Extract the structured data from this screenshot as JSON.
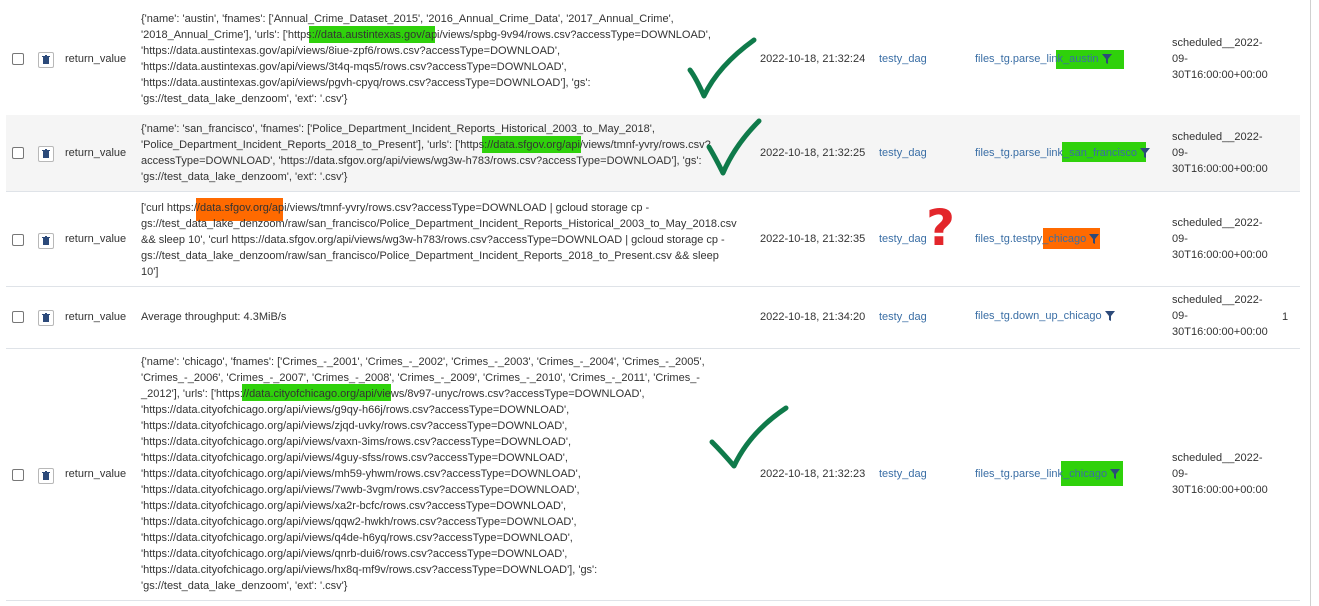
{
  "rows": [
    {
      "key": "return_value",
      "value": "{'name': 'austin', 'fnames': ['Annual_Crime_Dataset_2015', '2016_Annual_Crime_Data', '2017_Annual_Crime',\n'2018_Annual_Crime'], 'urls': ['https://data.austintexas.gov/api/views/spbg-9v94/rows.csv?accessType=DOWNLOAD',\n'https://data.austintexas.gov/api/views/8iue-zpf6/rows.csv?accessType=DOWNLOAD',\n'https://data.austintexas.gov/api/views/3t4q-mqs5/rows.csv?accessType=DOWNLOAD',\n'https://data.austintexas.gov/api/views/pgvh-cpyq/rows.csv?accessType=DOWNLOAD'], 'gs':\n'gs://test_data_lake_denzoom', 'ext': '.csv'}",
      "timestamp": "2022-10-18, 21:32:24",
      "dag_id": "testy_dag",
      "task_id": "files_tg.parse_link_austin",
      "run_id": "scheduled__2022-\n09-\n30T16:00:00+00:00",
      "map_index": ""
    },
    {
      "key": "return_value",
      "value": "{'name': 'san_francisco', 'fnames': ['Police_Department_Incident_Reports_Historical_2003_to_May_2018',\n'Police_Department_Incident_Reports_2018_to_Present'], 'urls': ['https://data.sfgov.org/api/views/tmnf-yvry/rows.csv?\naccessType=DOWNLOAD', 'https://data.sfgov.org/api/views/wg3w-h783/rows.csv?accessType=DOWNLOAD'], 'gs':\n'gs://test_data_lake_denzoom', 'ext': '.csv'}",
      "timestamp": "2022-10-18, 21:32:25",
      "dag_id": "testy_dag",
      "task_id": "files_tg.parse_link_san_francisco",
      "run_id": "scheduled__2022-\n09-\n30T16:00:00+00:00",
      "map_index": ""
    },
    {
      "key": "return_value",
      "value": "['curl https://data.sfgov.org/api/views/tmnf-yvry/rows.csv?accessType=DOWNLOAD | gcloud storage cp -\ngs://test_data_lake_denzoom/raw/san_francisco/Police_Department_Incident_Reports_Historical_2003_to_May_2018.csv\n&& sleep 10', 'curl https://data.sfgov.org/api/views/wg3w-h783/rows.csv?accessType=DOWNLOAD | gcloud storage cp -\ngs://test_data_lake_denzoom/raw/san_francisco/Police_Department_Incident_Reports_2018_to_Present.csv && sleep\n10']",
      "timestamp": "2022-10-18, 21:32:35",
      "dag_id": "testy_dag",
      "task_id": "files_tg.testpy_chicago",
      "run_id": "scheduled__2022-\n09-\n30T16:00:00+00:00",
      "map_index": ""
    },
    {
      "key": "return_value",
      "value": "Average throughput: 4.3MiB/s",
      "timestamp": "2022-10-18, 21:34:20",
      "dag_id": "testy_dag",
      "task_id": "files_tg.down_up_chicago",
      "run_id": "scheduled__2022-\n09-\n30T16:00:00+00:00",
      "map_index": "1"
    },
    {
      "key": "return_value",
      "value": "{'name': 'chicago', 'fnames': ['Crimes_-_2001', 'Crimes_-_2002', 'Crimes_-_2003', 'Crimes_-_2004', 'Crimes_-_2005',\n'Crimes_-_2006', 'Crimes_-_2007', 'Crimes_-_2008', 'Crimes_-_2009', 'Crimes_-_2010', 'Crimes_-_2011', 'Crimes_-\n_2012'], 'urls': ['https://data.cityofchicago.org/api/views/8v97-unyc/rows.csv?accessType=DOWNLOAD',\n'https://data.cityofchicago.org/api/views/g9qy-h66j/rows.csv?accessType=DOWNLOAD',\n'https://data.cityofchicago.org/api/views/zjqd-uvky/rows.csv?accessType=DOWNLOAD',\n'https://data.cityofchicago.org/api/views/vaxn-3ims/rows.csv?accessType=DOWNLOAD',\n'https://data.cityofchicago.org/api/views/4guy-sfss/rows.csv?accessType=DOWNLOAD',\n'https://data.cityofchicago.org/api/views/mh59-yhwm/rows.csv?accessType=DOWNLOAD',\n'https://data.cityofchicago.org/api/views/7wwb-3vgm/rows.csv?accessType=DOWNLOAD',\n'https://data.cityofchicago.org/api/views/xa2r-bcfc/rows.csv?accessType=DOWNLOAD',\n'https://data.cityofchicago.org/api/views/qqw2-hwkh/rows.csv?accessType=DOWNLOAD',\n'https://data.cityofchicago.org/api/views/q4de-h6yq/rows.csv?accessType=DOWNLOAD',\n'https://data.cityofchicago.org/api/views/qnrb-dui6/rows.csv?accessType=DOWNLOAD',\n'https://data.cityofchicago.org/api/views/hx8q-mf9v/rows.csv?accessType=DOWNLOAD'], 'gs':\n'gs://test_data_lake_denzoom', 'ext': '.csv'}",
      "timestamp": "2022-10-18, 21:32:23",
      "dag_id": "testy_dag",
      "task_id": "files_tg.parse_link_chicago",
      "run_id": "scheduled__2022-\n09-\n30T16:00:00+00:00",
      "map_index": ""
    }
  ],
  "annotations": {
    "checkmark_color": "#0f7a4a",
    "question_color": "#e3262b",
    "green_highlight": "#2fd10b",
    "orange_highlight": "#ff6a00",
    "question_mark": "?"
  },
  "icons": {
    "delete": "trash-icon",
    "filter": "filter-icon",
    "checkbox": "checkbox"
  }
}
